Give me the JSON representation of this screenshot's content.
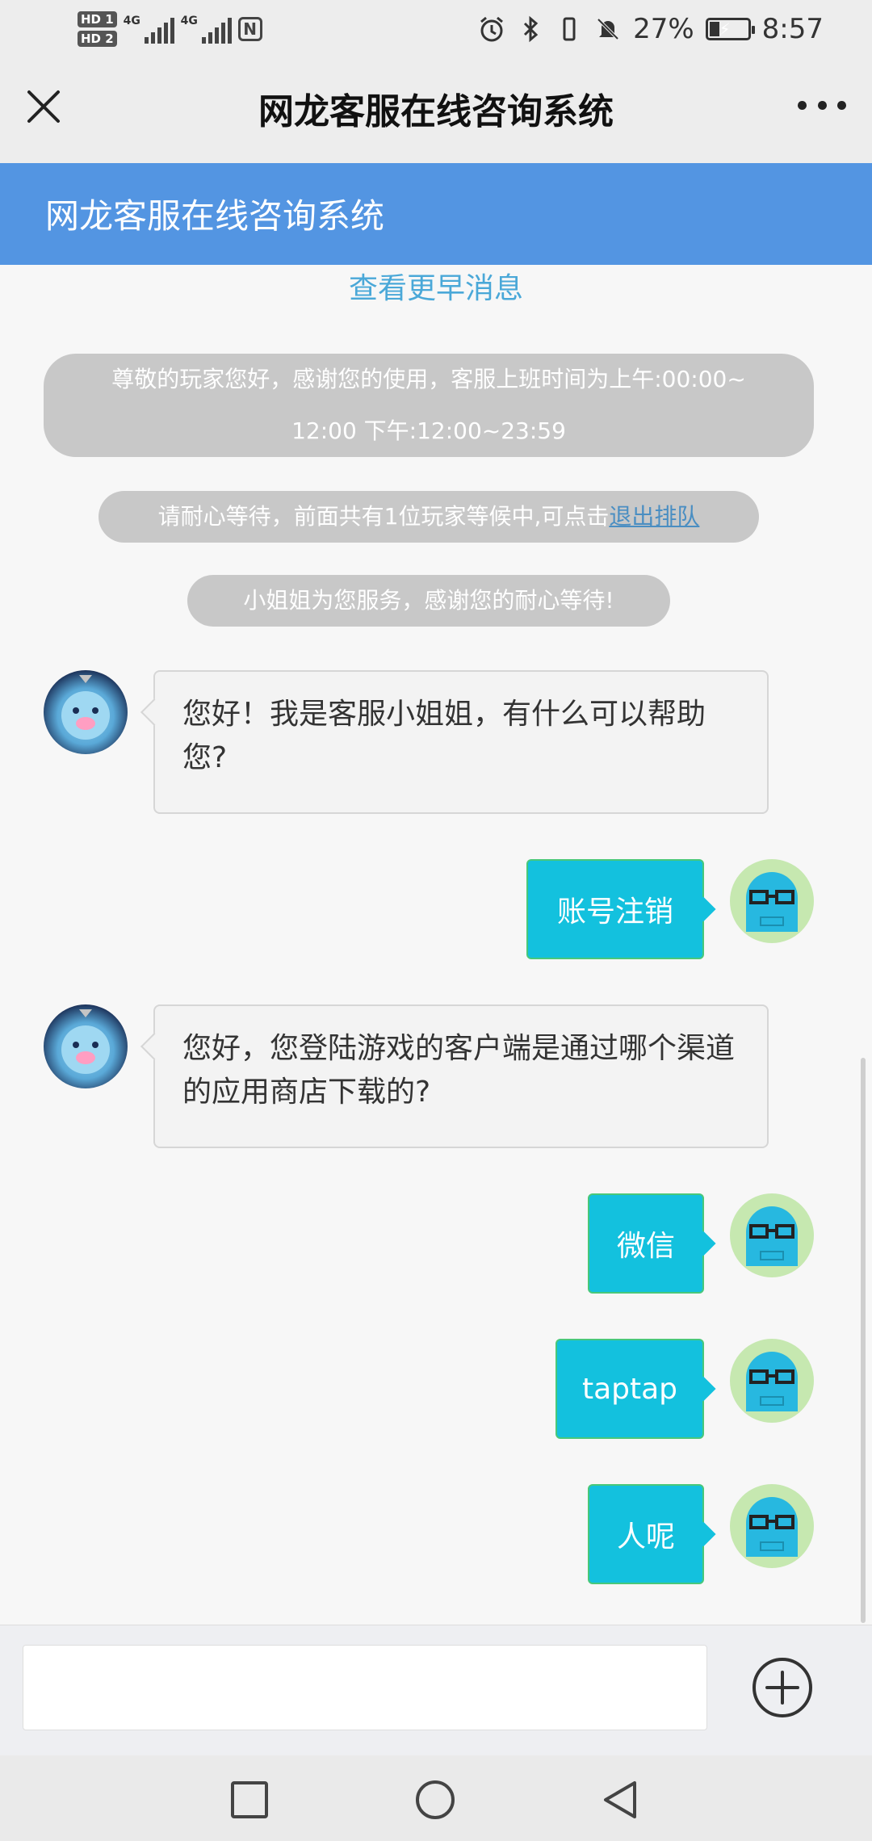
{
  "status_bar": {
    "hd1": "HD 1",
    "hd2": "HD 2",
    "net1": "4G",
    "net2": "4G",
    "battery_percent": "27%",
    "battery_level": 0.27,
    "time": "8:57"
  },
  "title_bar": {
    "title": "网龙客服在线咨询系统"
  },
  "header": {
    "title": "网龙客服在线咨询系统"
  },
  "chat": {
    "load_earlier": "查看更早消息",
    "notice_hours_line1": "尊敬的玩家您好，感谢您的使用，客服上班时间为上午:00:00~",
    "notice_hours_line2": "12:00 下午:12:00~23:59",
    "notice_queue_text": "请耐心等待，前面共有1位玩家等候中,可点击",
    "notice_queue_link": "退出排队",
    "notice_service": "小姐姐为您服务，感谢您的耐心等待!",
    "messages": [
      {
        "from": "agent",
        "text": "您好！我是客服小姐姐，有什么可以帮助您?"
      },
      {
        "from": "user",
        "text": "账号注销"
      },
      {
        "from": "agent",
        "text": "您好，您登陆游戏的客户端是通过哪个渠道的应用商店下载的?"
      },
      {
        "from": "user",
        "text": "微信"
      },
      {
        "from": "user",
        "text": "taptap"
      },
      {
        "from": "user",
        "text": "人呢"
      }
    ]
  },
  "input": {
    "value": "",
    "placeholder": ""
  },
  "colors": {
    "header_blue": "#5395e2",
    "user_bubble": "#13c1de",
    "link": "#4aa8d8"
  },
  "icons": {
    "close": "close-icon",
    "more": "more-icon",
    "plus": "plus-circle-icon",
    "nav_recent": "square-icon",
    "nav_home": "circle-icon",
    "nav_back": "triangle-back-icon"
  }
}
